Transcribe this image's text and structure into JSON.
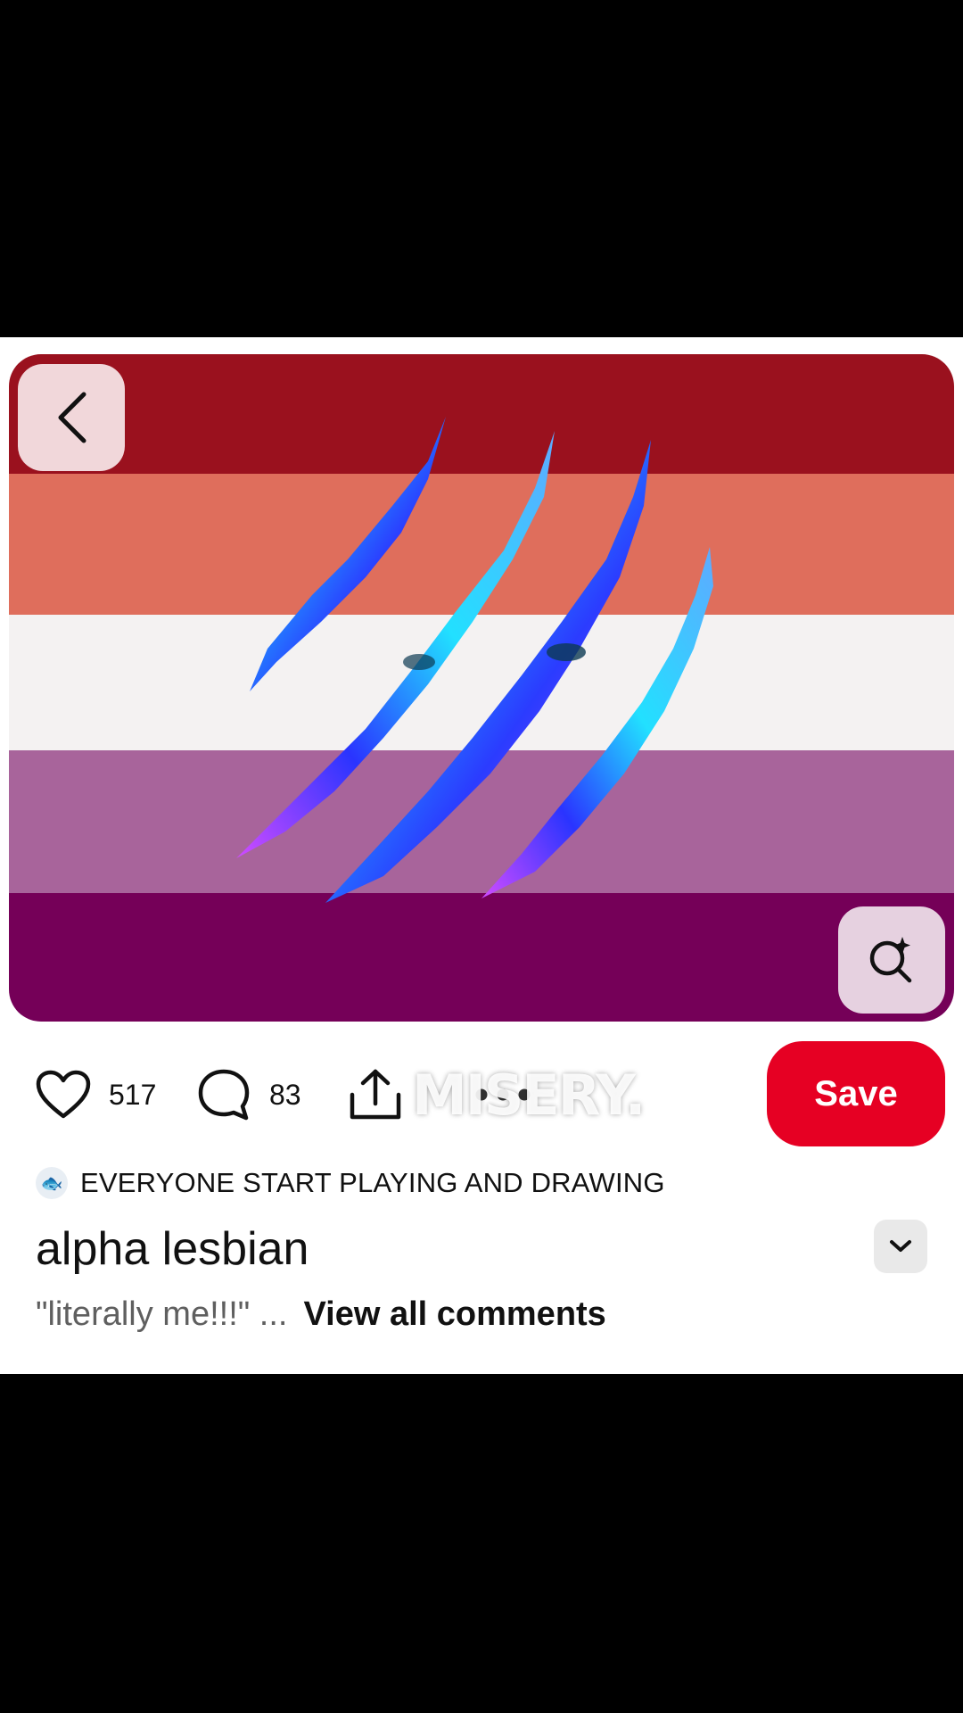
{
  "pin": {
    "image_alt": "Lesbian pride flag with claw marks",
    "flag_colors": [
      "#9a111e",
      "#df6e5c",
      "#f4f2f2",
      "#a8649b",
      "#750058"
    ],
    "watermark": "MISERY."
  },
  "actions": {
    "like_count": "517",
    "comment_count": "83",
    "save_label": "Save"
  },
  "board": {
    "icon": "fish-bowl-icon",
    "name": "EVERYONE START PLAYING AND DRAWING"
  },
  "title": "alpha lesbian",
  "comments": {
    "preview": "\"literally me!!!\" ...",
    "view_all": "View all comments"
  },
  "colors": {
    "save_button": "#e60023"
  }
}
